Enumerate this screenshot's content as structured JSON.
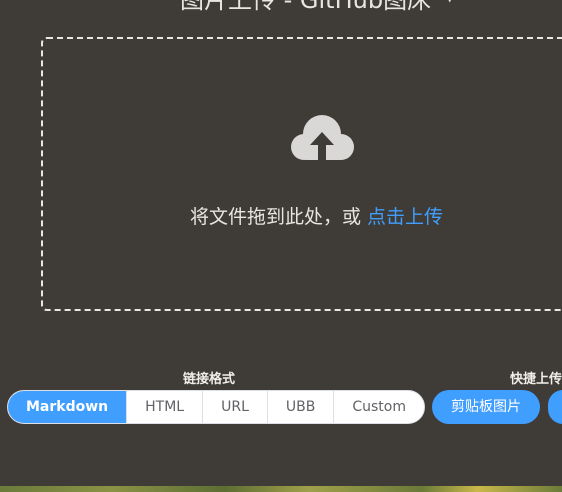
{
  "header": {
    "title": "图片上传 - GitHub图床",
    "caret_icon": "chevron-down-icon"
  },
  "dropzone": {
    "icon": "cloud-upload-icon",
    "prompt_text": "将文件拖到此处，或",
    "link_text": "点击上传"
  },
  "link_format": {
    "label": "链接格式",
    "options": [
      "Markdown",
      "HTML",
      "URL",
      "UBB",
      "Custom"
    ],
    "selected": "Markdown"
  },
  "quick_upload": {
    "label": "快捷上传",
    "clipboard_button": "剪贴板图片"
  },
  "colors": {
    "background": "#3f3c37",
    "accent": "#409eff",
    "text": "#e8e6e3"
  }
}
